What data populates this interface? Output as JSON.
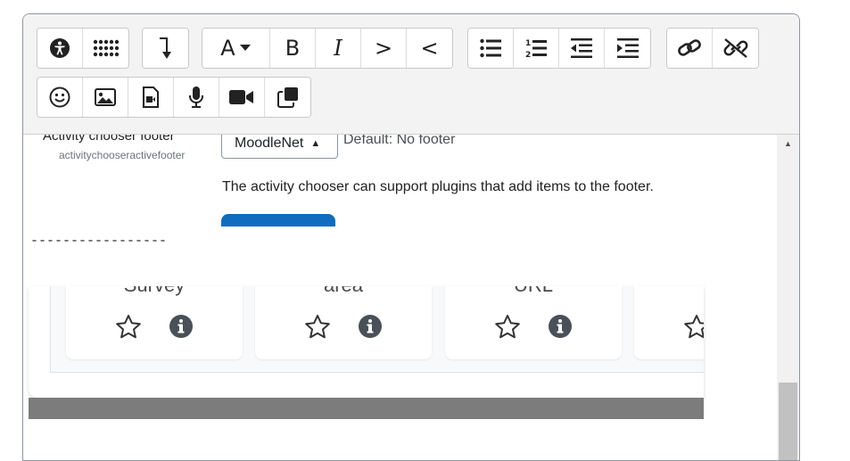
{
  "toolbar": {
    "row1": [
      {
        "name": "accessibility-checker-button",
        "icon": "accessibility-icon"
      },
      {
        "name": "screen-reader-helper-button",
        "icon": "braille-icon"
      },
      {
        "name": "toggle-toolbar-button",
        "icon": "level-down-icon"
      },
      {
        "name": "font-color-button",
        "glyph": "A",
        "icon": "caret-down-icon"
      },
      {
        "name": "bold-button",
        "glyph": "B"
      },
      {
        "name": "italic-button",
        "glyph": "I"
      },
      {
        "name": "ltr-button",
        "glyph": ">"
      },
      {
        "name": "rtl-button",
        "glyph": "<"
      },
      {
        "name": "unordered-list-button",
        "icon": "list-ul-icon"
      },
      {
        "name": "ordered-list-button",
        "icon": "list-ol-icon"
      },
      {
        "name": "outdent-button",
        "icon": "outdent-icon"
      },
      {
        "name": "indent-button",
        "icon": "indent-icon"
      },
      {
        "name": "link-button",
        "icon": "link-icon"
      },
      {
        "name": "unlink-button",
        "icon": "unlink-icon"
      }
    ],
    "row2": [
      {
        "name": "emoji-button",
        "icon": "smile-icon"
      },
      {
        "name": "image-button",
        "icon": "image-icon"
      },
      {
        "name": "media-button",
        "icon": "file-video-icon"
      },
      {
        "name": "record-audio-button",
        "icon": "microphone-icon"
      },
      {
        "name": "record-video-button",
        "icon": "video-camera-icon"
      },
      {
        "name": "manage-files-button",
        "icon": "copy-icon"
      }
    ]
  },
  "setting": {
    "name": "Activity chooser footer",
    "key": "activitychooseractivefooter",
    "selected": "MoodleNet",
    "default": "Default: No footer",
    "description": "The activity chooser can support plugins that add items to the footer."
  },
  "separator": "-----------------",
  "cards": [
    {
      "title": "Survey",
      "star": "star-icon",
      "info": "info-icon"
    },
    {
      "title": "area",
      "star": "star-icon",
      "info": "info-icon"
    },
    {
      "title": "URL",
      "star": "star-icon",
      "info": "info-icon"
    },
    {
      "title": "",
      "star": "star-icon",
      "info": "info-icon"
    }
  ],
  "colors": {
    "accent": "#0f6cbf",
    "icon": "#222222",
    "info": "#495057"
  }
}
